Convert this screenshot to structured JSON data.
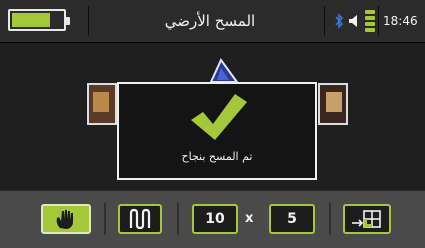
{
  "status_bar": {
    "title": "المسح الأرضي",
    "time": "18:46",
    "battery_level": 0.75
  },
  "dialog": {
    "message": "تم المسح بنجاح"
  },
  "toolbar": {
    "grid_width": "10",
    "times_symbol": "x",
    "grid_height": "5"
  },
  "colors": {
    "accent": "#a5c83a",
    "bluetooth": "#2f7bd6"
  }
}
